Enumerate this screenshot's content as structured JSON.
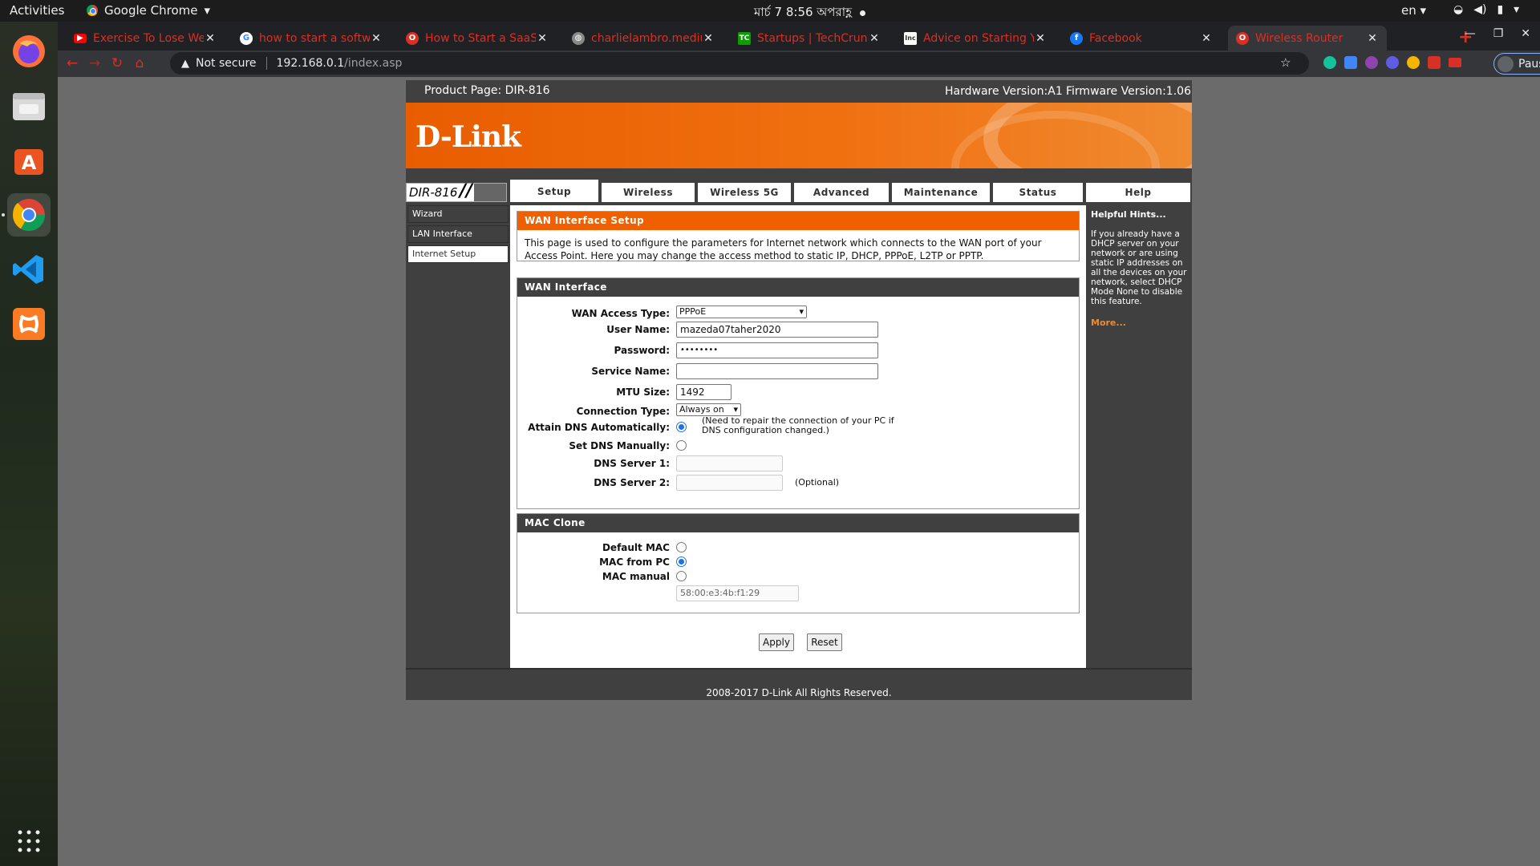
{
  "topbar": {
    "activities": "Activities",
    "app_name": "Google Chrome",
    "datetime": "মার্চ 7   8:56 অপরাহ্ণ",
    "language": "en"
  },
  "tabs": [
    {
      "title": "Exercise To Lose Wei",
      "favicon": "youtube-icon"
    },
    {
      "title": "how to start a softw",
      "favicon": "google-icon"
    },
    {
      "title": "How to Start a SaaS",
      "favicon": "opera-icon"
    },
    {
      "title": "charlielambro.mediu",
      "favicon": "globe-icon"
    },
    {
      "title": "Startups | TechCrunc",
      "favicon": "techcrunch-icon"
    },
    {
      "title": "Advice on Starting Y",
      "favicon": "inc-icon"
    },
    {
      "title": "Facebook",
      "favicon": "facebook-icon"
    },
    {
      "title": "Wireless Router",
      "favicon": "opera-icon"
    }
  ],
  "omnibox": {
    "security_label": "Not secure",
    "host": "192.168.0.1",
    "path": "/index.asp"
  },
  "profile": {
    "status": "Paused"
  },
  "router": {
    "product_page": "Product Page: DIR-816",
    "hardware_version": "Hardware Version:A1",
    "firmware_version": "Firmware Version:1.06",
    "logo": "D-Link",
    "model": "DIR-816",
    "nav_tabs": [
      "Setup",
      "Wireless",
      "Wireless 5G",
      "Advanced",
      "Maintenance",
      "Status",
      "Help"
    ],
    "left_nav": [
      "Wizard",
      "LAN Interface",
      "Internet Setup"
    ],
    "wan_setup": {
      "title": "WAN Interface Setup",
      "description": "This page is used to configure the parameters for Internet network which connects to the WAN port of your Access Point. Here you may change the access method to static IP, DHCP, PPPoE, L2TP or PPTP."
    },
    "wan_interface": {
      "title": "WAN Interface",
      "access_type_label": "WAN Access Type:",
      "access_type_value": "PPPoE",
      "username_label": "User Name:",
      "username_value": "mazeda07taher2020",
      "password_label": "Password:",
      "password_value": "••••••••",
      "service_name_label": "Service Name:",
      "service_name_value": "",
      "mtu_label": "MTU Size:",
      "mtu_value": "1492",
      "connection_type_label": "Connection Type:",
      "connection_type_value": "Always on",
      "attain_dns_label": "Attain DNS Automatically:",
      "attain_dns_note": "(Need to repair the connection of your PC if DNS configuration changed.)",
      "set_dns_label": "Set DNS Manually:",
      "dns1_label": "DNS Server 1:",
      "dns2_label": "DNS Server 2:",
      "dns2_note": "(Optional)"
    },
    "mac_clone": {
      "title": "MAC Clone",
      "default_label": "Default MAC",
      "from_pc_label": "MAC from PC",
      "manual_label": "MAC manual",
      "manual_value": "58:00:e3:4b:f1:29"
    },
    "buttons": {
      "apply": "Apply",
      "reset": "Reset"
    },
    "hints": {
      "title": "Helpful Hints...",
      "text": "If you already have a DHCP server on your network or are using static IP addresses on all the devices on your network, select DHCP Mode None to disable this feature.",
      "more": "More..."
    },
    "footer": "2008-2017 D-Link All Rights Reserved."
  },
  "colors": {
    "dlink_orange": "#f06000",
    "router_dark": "#404040",
    "tab_text_red": "#d93025"
  }
}
